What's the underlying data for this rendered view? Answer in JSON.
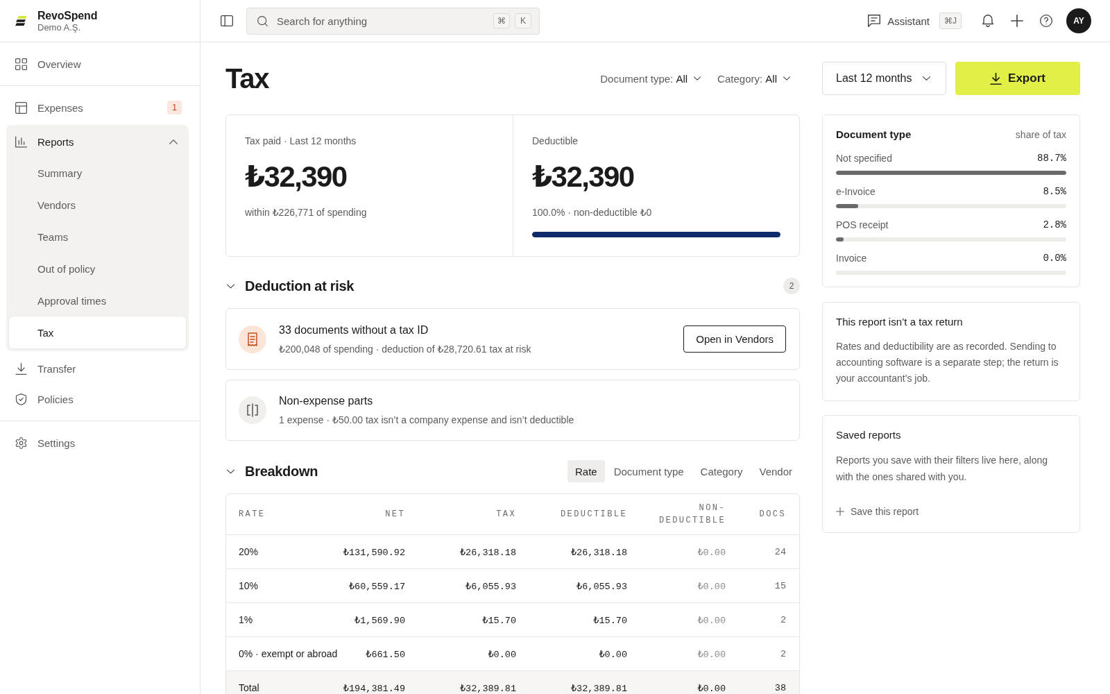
{
  "sidebar": {
    "brand": {
      "name": "RevoSpend",
      "workspace": "Demo A.Ş."
    },
    "sections": [
      {
        "items": [
          {
            "label": "Overview",
            "selected": false
          }
        ]
      },
      {
        "items": [
          {
            "label": "Expenses",
            "selected": false,
            "badge": "1"
          },
          {
            "label": "Reports",
            "selected": false,
            "expanded": true,
            "children": [
              {
                "label": "Summary",
                "selected": false
              },
              {
                "label": "Vendors",
                "selected": false
              },
              {
                "label": "Teams",
                "selected": false
              },
              {
                "label": "Out of policy",
                "selected": false
              },
              {
                "label": "Approval times",
                "selected": false
              },
              {
                "label": "Tax",
                "selected": true
              }
            ]
          },
          {
            "label": "Transfer",
            "selected": false
          },
          {
            "label": "Policies",
            "selected": false
          }
        ]
      },
      {
        "items": [
          {
            "label": "Settings",
            "selected": false
          }
        ]
      }
    ]
  },
  "top_bar": {
    "search": {
      "placeholder": "Search for anything",
      "shortcut": [
        "⌘",
        "K"
      ]
    },
    "assistant": {
      "label": "Assistant",
      "shortcut": "⌘J"
    },
    "avatar": {
      "initials": "AY"
    }
  },
  "page": {
    "title": "Tax",
    "filters": [
      {
        "label": "Document type:",
        "value": "All"
      },
      {
        "label": "Category:",
        "value": "All"
      }
    ],
    "period": "Last 12 months",
    "export": "Export"
  },
  "stats": [
    {
      "label": "Tax paid · Last 12 months",
      "value": "₺32,390",
      "note": "within ₺226,771 of spending"
    },
    {
      "label": "Deductible",
      "value": "₺32,390",
      "note": "100.0% · non-deductible ₺0",
      "level": 1.0
    }
  ],
  "deduction_at_risk": {
    "title": "Deduction at risk",
    "expanded": true,
    "count": "2",
    "items": [
      {
        "kind": "warning",
        "title": "33 documents without a tax ID",
        "detail": "₺200,048 of spending · deduction of ₺28,720.61 tax at risk",
        "action": "Open in Vendors"
      },
      {
        "kind": "neutral",
        "title": "Non-expense parts",
        "detail": "1 expense · ₺50.00 tax isn’t a company expense and isn’t deductible"
      }
    ]
  },
  "breakdown": {
    "title": "Breakdown",
    "expanded": true,
    "tabs": [
      {
        "label": "Rate",
        "selected": true
      },
      {
        "label": "Document type",
        "selected": false
      },
      {
        "label": "Category",
        "selected": false
      },
      {
        "label": "Vendor",
        "selected": false
      }
    ],
    "table": {
      "columns": [
        "RATE",
        "NET",
        "TAX",
        "DEDUCTIBLE",
        "NON-DEDUCTIBLE",
        "DOCS"
      ],
      "rows": [
        [
          "20%",
          "₺131,590.92",
          "₺26,318.18",
          "₺26,318.18",
          "₺0.00",
          "24"
        ],
        [
          "10%",
          "₺60,559.17",
          "₺6,055.93",
          "₺6,055.93",
          "₺0.00",
          "15"
        ],
        [
          "1%",
          "₺1,569.90",
          "₺15.70",
          "₺15.70",
          "₺0.00",
          "2"
        ],
        [
          "0% · exempt or abroad",
          "₺661.50",
          "₺0.00",
          "₺0.00",
          "₺0.00",
          "2"
        ]
      ],
      "total": [
        "Total",
        "₺194,381.49",
        "₺32,389.81",
        "₺32,389.81",
        "₺0.00",
        "38"
      ]
    }
  },
  "document_type": {
    "title": "Document type",
    "caption": "share of tax",
    "rows": [
      {
        "label": "Not specified",
        "value": "88.7%",
        "level": 1.0
      },
      {
        "label": "e-Invoice",
        "value": "8.5%",
        "level": 0.096
      },
      {
        "label": "POS receipt",
        "value": "2.8%",
        "level": 0.032
      },
      {
        "label": "Invoice",
        "value": "0.0%"
      }
    ]
  },
  "notice": {
    "title": "This report isn’t a tax return",
    "body": "Rates and deductibility are as recorded. Sending to accounting software is a separate step; the return is your accountant’s job."
  },
  "saved_reports": {
    "title": "Saved reports",
    "body": "Reports you save with their filters live here, along with the ones shared with you.",
    "action": "Save this report"
  }
}
